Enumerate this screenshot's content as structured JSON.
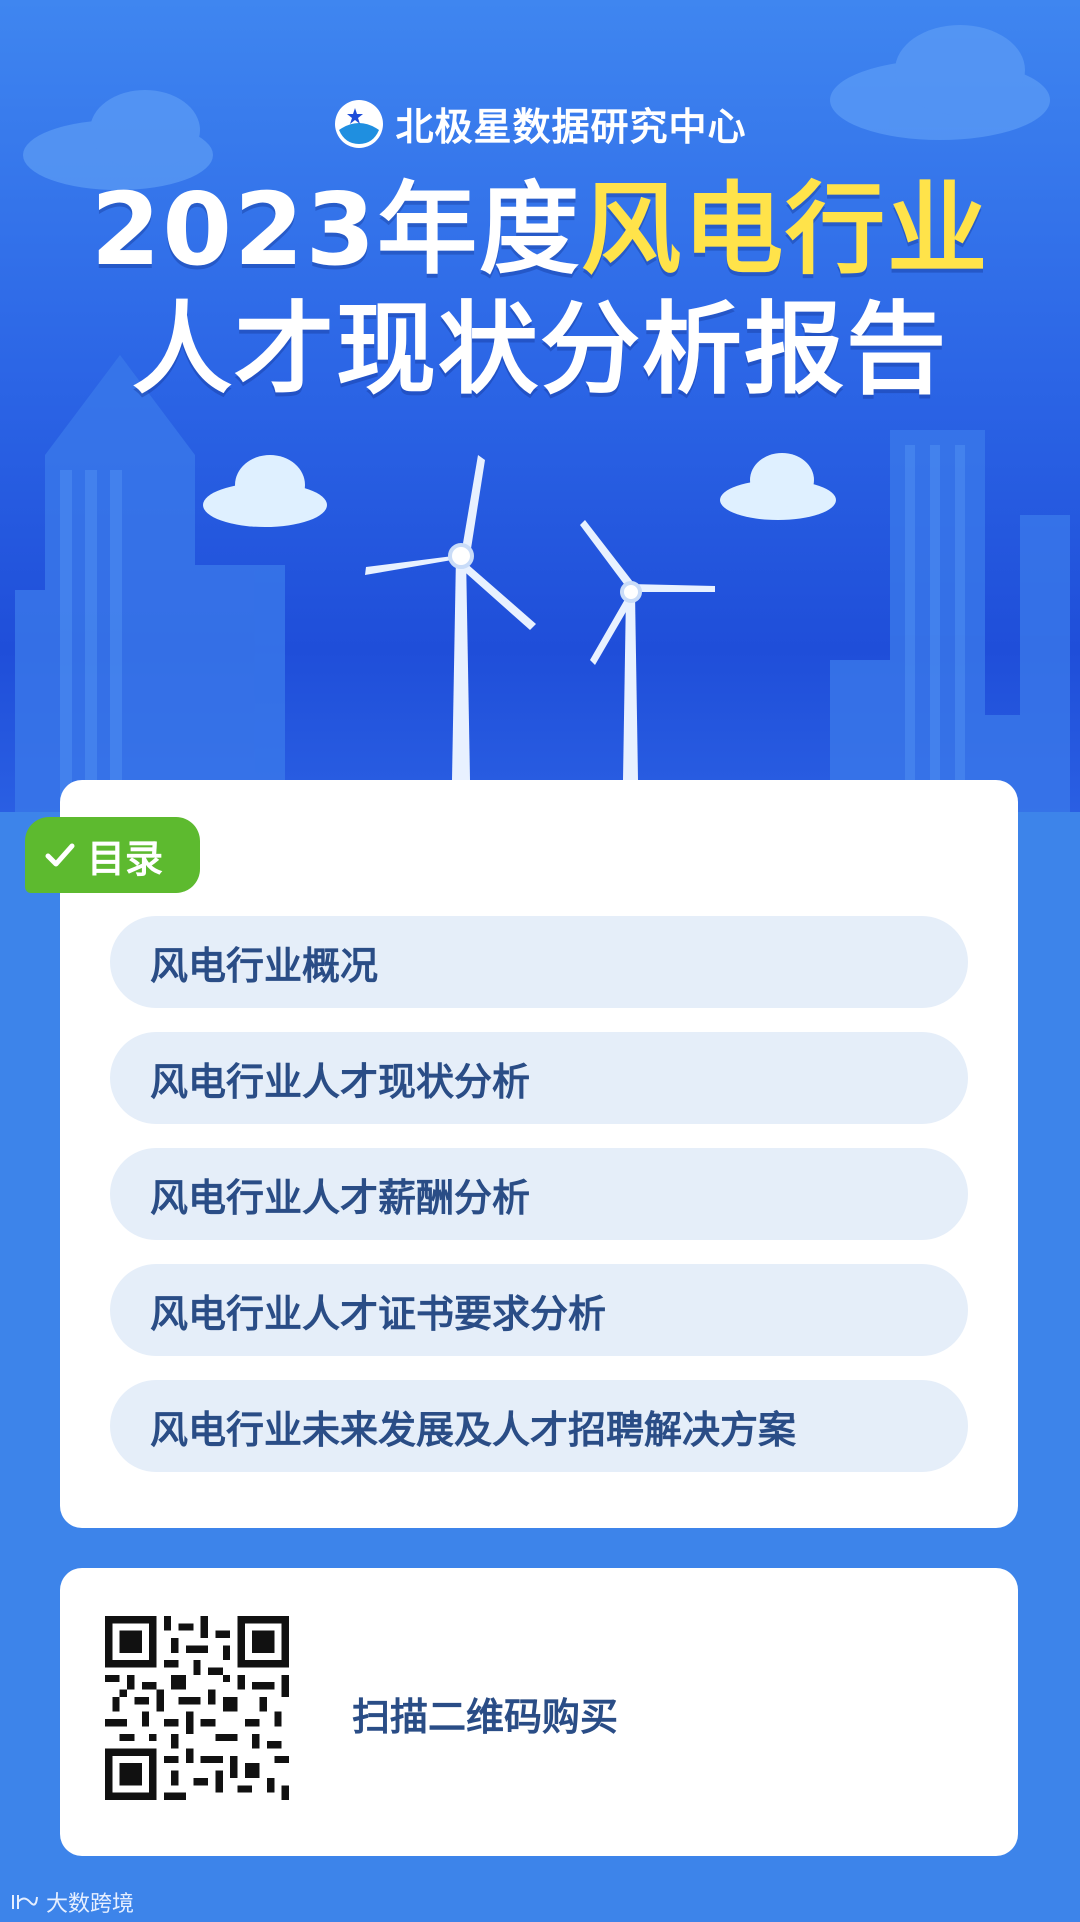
{
  "header": {
    "brand": "北极星数据研究中心",
    "title_prefix": "2023年度",
    "title_highlight": "风电行业",
    "title_line2": "人才现状分析报告"
  },
  "toc": {
    "badge_label": "目录",
    "items": [
      {
        "label": "风电行业概况"
      },
      {
        "label": "风电行业人才现状分析"
      },
      {
        "label": "风电行业人才薪酬分析"
      },
      {
        "label": "风电行业人才证书要求分析"
      },
      {
        "label": "风电行业未来发展及人才招聘解决方案"
      }
    ]
  },
  "purchase": {
    "qr_label": "扫描二维码购买"
  },
  "watermark": {
    "text": "大数跨境"
  },
  "colors": {
    "hero_blue": "#2c66e6",
    "page_blue": "#3d84ea",
    "highlight_yellow": "#ffe34a",
    "badge_green": "#5dba2f",
    "item_text": "#2a4d86",
    "item_bg": "#e5eef9"
  }
}
